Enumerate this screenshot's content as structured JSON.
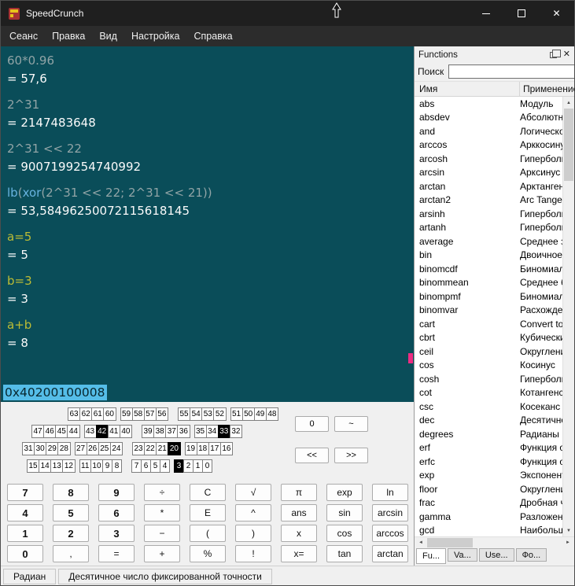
{
  "window": {
    "title": "SpeedCrunch"
  },
  "icons": {
    "close": "✕",
    "up": "▲",
    "down": "▼",
    "left": "◄",
    "right": "►"
  },
  "menubar": {
    "items": [
      "Сеанс",
      "Правка",
      "Вид",
      "Настройка",
      "Справка"
    ]
  },
  "display": {
    "history": [
      {
        "segments": [
          {
            "t": "60*0.96",
            "c": "expr"
          }
        ],
        "result": "= 57,6"
      },
      {
        "segments": [
          {
            "t": "2^31",
            "c": "expr"
          }
        ],
        "result": "= 2147483648"
      },
      {
        "segments": [
          {
            "t": "2^31 << 22",
            "c": "expr"
          }
        ],
        "result": "= 9007199254740992"
      },
      {
        "segments": [
          {
            "t": "lb",
            "c": "func"
          },
          {
            "t": "(",
            "c": "expr"
          },
          {
            "t": "xor",
            "c": "func"
          },
          {
            "t": "(2^31 << 22; 2^31 << 21))",
            "c": "expr"
          }
        ],
        "result": "= 53,58496250072115618145"
      },
      {
        "segments": [
          {
            "t": "a=5",
            "c": "var"
          }
        ],
        "result": "= 5"
      },
      {
        "segments": [
          {
            "t": "b=3",
            "c": "var"
          }
        ],
        "result": "= 3"
      },
      {
        "segments": [
          {
            "t": "a+b",
            "c": "var"
          }
        ],
        "result": "= 8"
      }
    ],
    "input_value": "0x40200100008"
  },
  "bitfield": {
    "rows": [
      [
        [
          63,
          62,
          61,
          60
        ],
        [
          59,
          58,
          57,
          56
        ],
        [
          55,
          54,
          53,
          52
        ],
        [
          51,
          50,
          49,
          48
        ]
      ],
      [
        [
          47,
          46,
          45,
          44
        ],
        [
          43,
          42,
          41,
          40
        ],
        [
          39,
          38,
          37,
          36
        ],
        [
          35,
          34,
          33,
          32
        ]
      ],
      [
        [
          31,
          30,
          29,
          28
        ],
        [
          27,
          26,
          25,
          24
        ],
        [
          23,
          22,
          21,
          20
        ],
        [
          19,
          18,
          17,
          16
        ]
      ],
      [
        [
          15,
          14,
          13,
          12
        ],
        [
          11,
          10,
          9,
          8
        ],
        [
          7,
          6,
          5,
          4
        ],
        [
          3,
          2,
          1,
          0
        ]
      ]
    ],
    "set_bits": [
      42,
      33,
      20,
      3
    ],
    "buttons": [
      "0",
      "~",
      "<<",
      ">>"
    ]
  },
  "keypad": {
    "rows": [
      [
        "7",
        "8",
        "9",
        "÷",
        "C",
        "√",
        "π",
        "exp",
        "ln"
      ],
      [
        "4",
        "5",
        "6",
        "*",
        "E",
        "^",
        "ans",
        "sin",
        "arcsin"
      ],
      [
        "1",
        "2",
        "3",
        "−",
        "(",
        ")",
        "x",
        "cos",
        "arccos"
      ],
      [
        "0",
        ",",
        "=",
        "+",
        "%",
        "!",
        "x=",
        "tan",
        "arctan"
      ]
    ]
  },
  "statusbar": {
    "items": [
      "Радиан",
      "Десятичное число фиксированной точности"
    ]
  },
  "functions_panel": {
    "title": "Functions",
    "search_label": "Поиск",
    "search_value": "",
    "columns": [
      "Имя",
      "Применение"
    ],
    "rows": [
      [
        "abs",
        "Модуль"
      ],
      [
        "absdev",
        "Абсолютное отклонение"
      ],
      [
        "and",
        "Логическое И"
      ],
      [
        "arccos",
        "Арккосинус"
      ],
      [
        "arcosh",
        "Гиперболический арккосинус"
      ],
      [
        "arcsin",
        "Арксинус"
      ],
      [
        "arctan",
        "Арктангенс"
      ],
      [
        "arctan2",
        "Arc Tangent"
      ],
      [
        "arsinh",
        "Гиперболический арксинус"
      ],
      [
        "artanh",
        "Гиперболический арктангенс"
      ],
      [
        "average",
        "Среднее значение"
      ],
      [
        "bin",
        "Двоичное представление"
      ],
      [
        "binomcdf",
        "Биномиальное распределение"
      ],
      [
        "binommean",
        "Среднее биномиальное"
      ],
      [
        "binompmf",
        "Биномиальная вероятность"
      ],
      [
        "binomvar",
        "Расхождение биномиальное"
      ],
      [
        "cart",
        "Convert to cartesian"
      ],
      [
        "cbrt",
        "Кубический корень"
      ],
      [
        "ceil",
        "Округление вверх"
      ],
      [
        "cos",
        "Косинус"
      ],
      [
        "cosh",
        "Гиперболический косинус"
      ],
      [
        "cot",
        "Котангенс"
      ],
      [
        "csc",
        "Косеканс"
      ],
      [
        "dec",
        "Десятичное представление"
      ],
      [
        "degrees",
        "Радианы в градусы"
      ],
      [
        "erf",
        "Функция ошибок"
      ],
      [
        "erfc",
        "Функция ошибок"
      ],
      [
        "exp",
        "Экспонента"
      ],
      [
        "floor",
        "Округление вниз"
      ],
      [
        "frac",
        "Дробная часть"
      ],
      [
        "gamma",
        "Разложение гамма"
      ],
      [
        "gcd",
        "Наибольший общий делитель"
      ]
    ],
    "tabs": [
      {
        "label": "Fu...",
        "active": true
      },
      {
        "label": "Va...",
        "active": false
      },
      {
        "label": "Use...",
        "active": false
      },
      {
        "label": "Фо...",
        "active": false
      }
    ]
  }
}
